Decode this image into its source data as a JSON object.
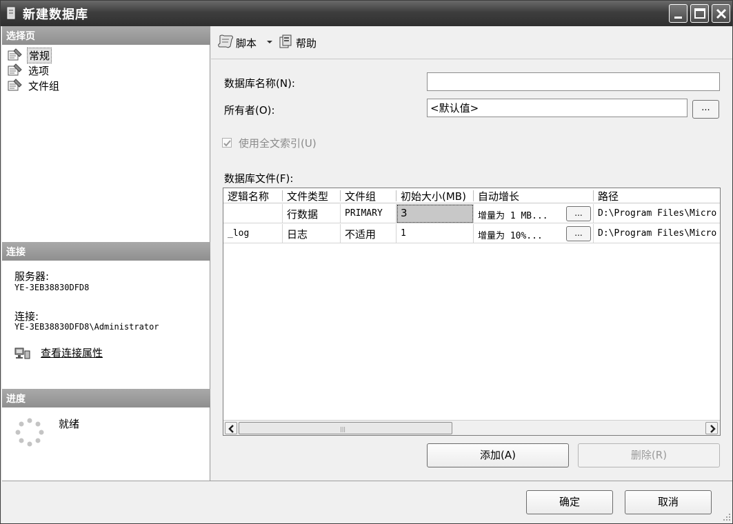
{
  "window": {
    "title": "新建数据库"
  },
  "left": {
    "select_page_header": "选择页",
    "pages": [
      {
        "label": "常规"
      },
      {
        "label": "选项"
      },
      {
        "label": "文件组"
      }
    ],
    "connection_header": "连接",
    "server_label": "服务器:",
    "server_value": "YE-3EB38830DFD8",
    "connection_label": "连接:",
    "connection_value": "YE-3EB38830DFD8\\Administrator",
    "view_properties_link": "查看连接属性",
    "progress_header": "进度",
    "progress_status": "就绪"
  },
  "toolbar": {
    "script_label": "脚本",
    "help_label": "帮助"
  },
  "form": {
    "db_name_label": "数据库名称(N):",
    "db_name_value": "",
    "owner_label": "所有者(O):",
    "owner_value": "<默认值>",
    "browse_label": "...",
    "fulltext_label": "使用全文索引(U)",
    "db_files_label": "数据库文件(F):"
  },
  "grid": {
    "columns": [
      "逻辑名称",
      "文件类型",
      "文件组",
      "初始大小(MB)",
      "自动增长",
      "路径"
    ],
    "rows": [
      {
        "logical_name": "",
        "file_type": "行数据",
        "filegroup": "PRIMARY",
        "size": "3",
        "growth": "增量为 1 MB...",
        "path": "D:\\Program Files\\Micro"
      },
      {
        "logical_name": "_log",
        "file_type": "日志",
        "filegroup": "不适用",
        "size": "1",
        "growth": "增量为 10%...",
        "path": "D:\\Program Files\\Micro"
      }
    ],
    "ellipsis_label": "...",
    "scroll_grip": "|||"
  },
  "buttons": {
    "add_label": "添加(A)",
    "remove_label": "删除(R)",
    "ok_label": "确定",
    "cancel_label": "取消"
  }
}
